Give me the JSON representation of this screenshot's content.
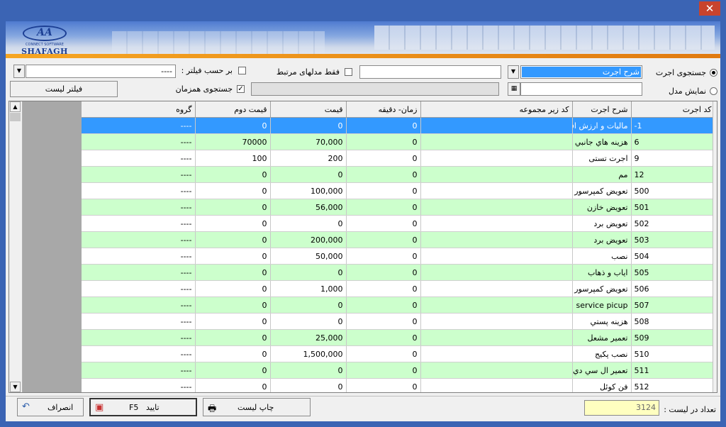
{
  "window": {
    "close_glyph": "✕"
  },
  "logo": {
    "mark": "AA",
    "sub": "CONNECT SOFTWARE",
    "brand": "SHAFAGH"
  },
  "search": {
    "radio_search_label": "جستجوی اجرت",
    "radio_model_label": "نمایش مدل",
    "field_selected": "شرح اجرت",
    "related_models_label": "فقط مدلهای مرتبط",
    "by_filter_label": "بر حسب فیلتر :",
    "filter_value": "----",
    "simultaneous_label": "جستجوی همزمان",
    "filter_list_button": "فیلتر لیست"
  },
  "grid": {
    "columns": [
      "کد اجرت",
      "شرح اجرت",
      "کد زیر مجموعه",
      "زمان- دقیقه",
      "قیمت",
      "قیمت دوم",
      "گروه"
    ],
    "rows": [
      {
        "code": "-1",
        "desc": "مالیات و ارزش افزوده",
        "sub": "",
        "time": "0",
        "price": "0",
        "price2": "0",
        "group": "----",
        "style": "sel"
      },
      {
        "code": "6",
        "desc": "هزينه هاي جانبي",
        "sub": "",
        "time": "0",
        "price": "70,000",
        "price2": "70000",
        "group": "----",
        "style": "g"
      },
      {
        "code": "9",
        "desc": "اجرت تستی",
        "sub": "",
        "time": "0",
        "price": "200",
        "price2": "100",
        "group": "----",
        "style": "w"
      },
      {
        "code": "12",
        "desc": "مم",
        "sub": "",
        "time": "0",
        "price": "0",
        "price2": "0",
        "group": "----",
        "style": "g"
      },
      {
        "code": "500",
        "desc": "تعویض کمپرسور",
        "sub": "",
        "time": "0",
        "price": "100,000",
        "price2": "0",
        "group": "----",
        "style": "w"
      },
      {
        "code": "501",
        "desc": "تعویض خازن",
        "sub": "",
        "time": "0",
        "price": "56,000",
        "price2": "0",
        "group": "----",
        "style": "g"
      },
      {
        "code": "502",
        "desc": "تعویض برد",
        "sub": "",
        "time": "0",
        "price": "0",
        "price2": "0",
        "group": "----",
        "style": "w"
      },
      {
        "code": "503",
        "desc": "تعویض برد",
        "sub": "",
        "time": "0",
        "price": "200,000",
        "price2": "0",
        "group": "----",
        "style": "g"
      },
      {
        "code": "504",
        "desc": "نصب",
        "sub": "",
        "time": "0",
        "price": "50,000",
        "price2": "0",
        "group": "----",
        "style": "w"
      },
      {
        "code": "505",
        "desc": "اياب و ذهاب",
        "sub": "",
        "time": "0",
        "price": "0",
        "price2": "0",
        "group": "----",
        "style": "g"
      },
      {
        "code": "506",
        "desc": "تعویض کمپرسور",
        "sub": "",
        "time": "0",
        "price": "1,000",
        "price2": "0",
        "group": "----",
        "style": "w"
      },
      {
        "code": "507",
        "desc": "service picup",
        "sub": "",
        "time": "0",
        "price": "0",
        "price2": "0",
        "group": "----",
        "style": "g"
      },
      {
        "code": "508",
        "desc": "هزينه پستي",
        "sub": "",
        "time": "0",
        "price": "0",
        "price2": "0",
        "group": "----",
        "style": "w"
      },
      {
        "code": "509",
        "desc": "تعمیر مشعل",
        "sub": "",
        "time": "0",
        "price": "25,000",
        "price2": "0",
        "group": "----",
        "style": "g"
      },
      {
        "code": "510",
        "desc": "نصب پکیج",
        "sub": "",
        "time": "0",
        "price": "1,500,000",
        "price2": "0",
        "group": "----",
        "style": "w"
      },
      {
        "code": "511",
        "desc": "تعمیر ال سي دي",
        "sub": "",
        "time": "0",
        "price": "0",
        "price2": "0",
        "group": "----",
        "style": "g"
      },
      {
        "code": "512",
        "desc": "فن کوئل",
        "sub": "",
        "time": "0",
        "price": "0",
        "price2": "0",
        "group": "----",
        "style": "w"
      }
    ]
  },
  "footer": {
    "count_label": "تعداد در لیست :",
    "count_value": "3124",
    "print_button": "چاپ لیست",
    "confirm_button": "تایید",
    "confirm_key": "F5",
    "cancel_button": "انصراف"
  }
}
